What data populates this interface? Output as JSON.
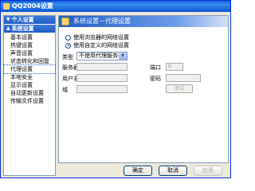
{
  "window": {
    "title": "QQ2004设置"
  },
  "sidebar": {
    "groups": [
      {
        "label": "个人设置",
        "collapsed": true
      },
      {
        "label": "系统设置",
        "collapsed": false
      }
    ],
    "items": [
      {
        "label": "基本设置"
      },
      {
        "label": "热键设置"
      },
      {
        "label": "声音设置"
      },
      {
        "label": "状态转化和回复"
      },
      {
        "label": "代理设置",
        "active": true
      },
      {
        "label": "本地安全"
      },
      {
        "label": "显示设置"
      },
      {
        "label": "自动更新设置"
      },
      {
        "label": "传输文件设置"
      }
    ]
  },
  "panel": {
    "header": "系统设置－代理设置",
    "radio_browser": "使用浏览器的网络设置",
    "radio_custom": "使用自定义的网络设置",
    "type_label": "类型",
    "type_value": "不使用代理服务器",
    "server_label": "服务器",
    "port_label": "端口",
    "port_value": "0",
    "user_label": "用户名",
    "password_label": "密码",
    "domain_label": "域",
    "test_button": "测试"
  },
  "footer": {
    "ok": "确定",
    "cancel": "取消",
    "apply": "应用"
  },
  "colors": {
    "titlebar": "#0a5fd8",
    "accent": "#1f5cc5",
    "window_bg": "#ece9d8"
  }
}
